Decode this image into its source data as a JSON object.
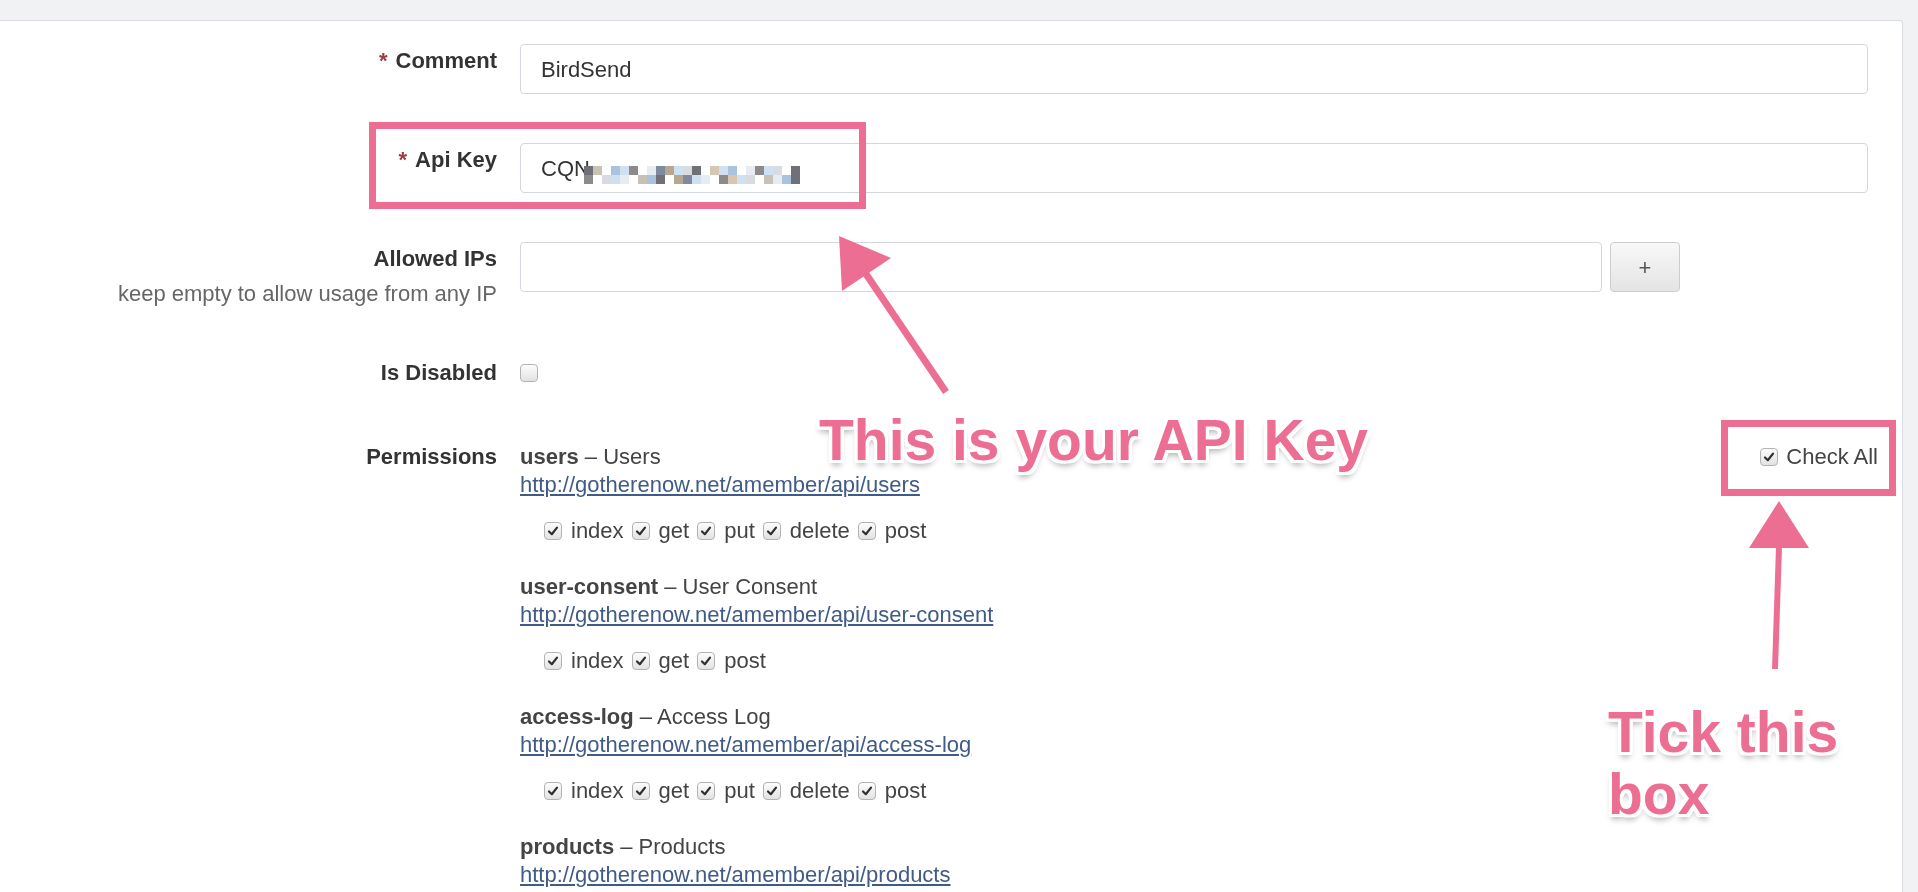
{
  "form": {
    "fields": [
      {
        "kind": "text",
        "required_mark": "*",
        "label": "Comment",
        "value": "BirdSend",
        "redacted": false,
        "highlighted": false
      },
      {
        "kind": "text",
        "required_mark": "*",
        "label": "Api Key",
        "value": "CQN",
        "redacted": true,
        "highlighted": true
      },
      {
        "kind": "multi",
        "label": "Allowed IPs",
        "hint": "keep empty to allow usage from any IP",
        "add_button": "+",
        "highlighted": false
      },
      {
        "kind": "checkbox",
        "label": "Is Disabled",
        "checked": false,
        "highlighted": false
      },
      {
        "kind": "permissions",
        "label": "Permissions",
        "highlighted": false,
        "check_all": {
          "label": "Check All",
          "checked": true,
          "highlighted": true
        },
        "groups": [
          {
            "heading": "**users** – Users",
            "url": "http://gotherenow.net/amember/api/users",
            "methods": [
              {
                "label": "index",
                "checked": true
              },
              {
                "label": "get",
                "checked": true
              },
              {
                "label": "put",
                "checked": true
              },
              {
                "label": "delete",
                "checked": true
              },
              {
                "label": "post",
                "checked": true
              }
            ]
          },
          {
            "heading": "**user-consent** – User Consent",
            "url": "http://gotherenow.net/amember/api/user-consent",
            "methods": [
              {
                "label": "index",
                "checked": true
              },
              {
                "label": "get",
                "checked": true
              },
              {
                "label": "post",
                "checked": true
              }
            ]
          },
          {
            "heading": "**access-log** – Access Log",
            "url": "http://gotherenow.net/amember/api/access-log",
            "methods": [
              {
                "label": "index",
                "checked": true
              },
              {
                "label": "get",
                "checked": true
              },
              {
                "label": "put",
                "checked": true
              },
              {
                "label": "delete",
                "checked": true
              },
              {
                "label": "post",
                "checked": true
              }
            ]
          },
          {
            "heading": "**products** – Products",
            "url": "http://gotherenow.net/amember/api/products"
          }
        ]
      }
    ]
  },
  "callouts": [
    {
      "kind": "callout",
      "text": "This is your API Key"
    },
    {
      "kind": "callout",
      "text": "Tick this box"
    }
  ]
}
